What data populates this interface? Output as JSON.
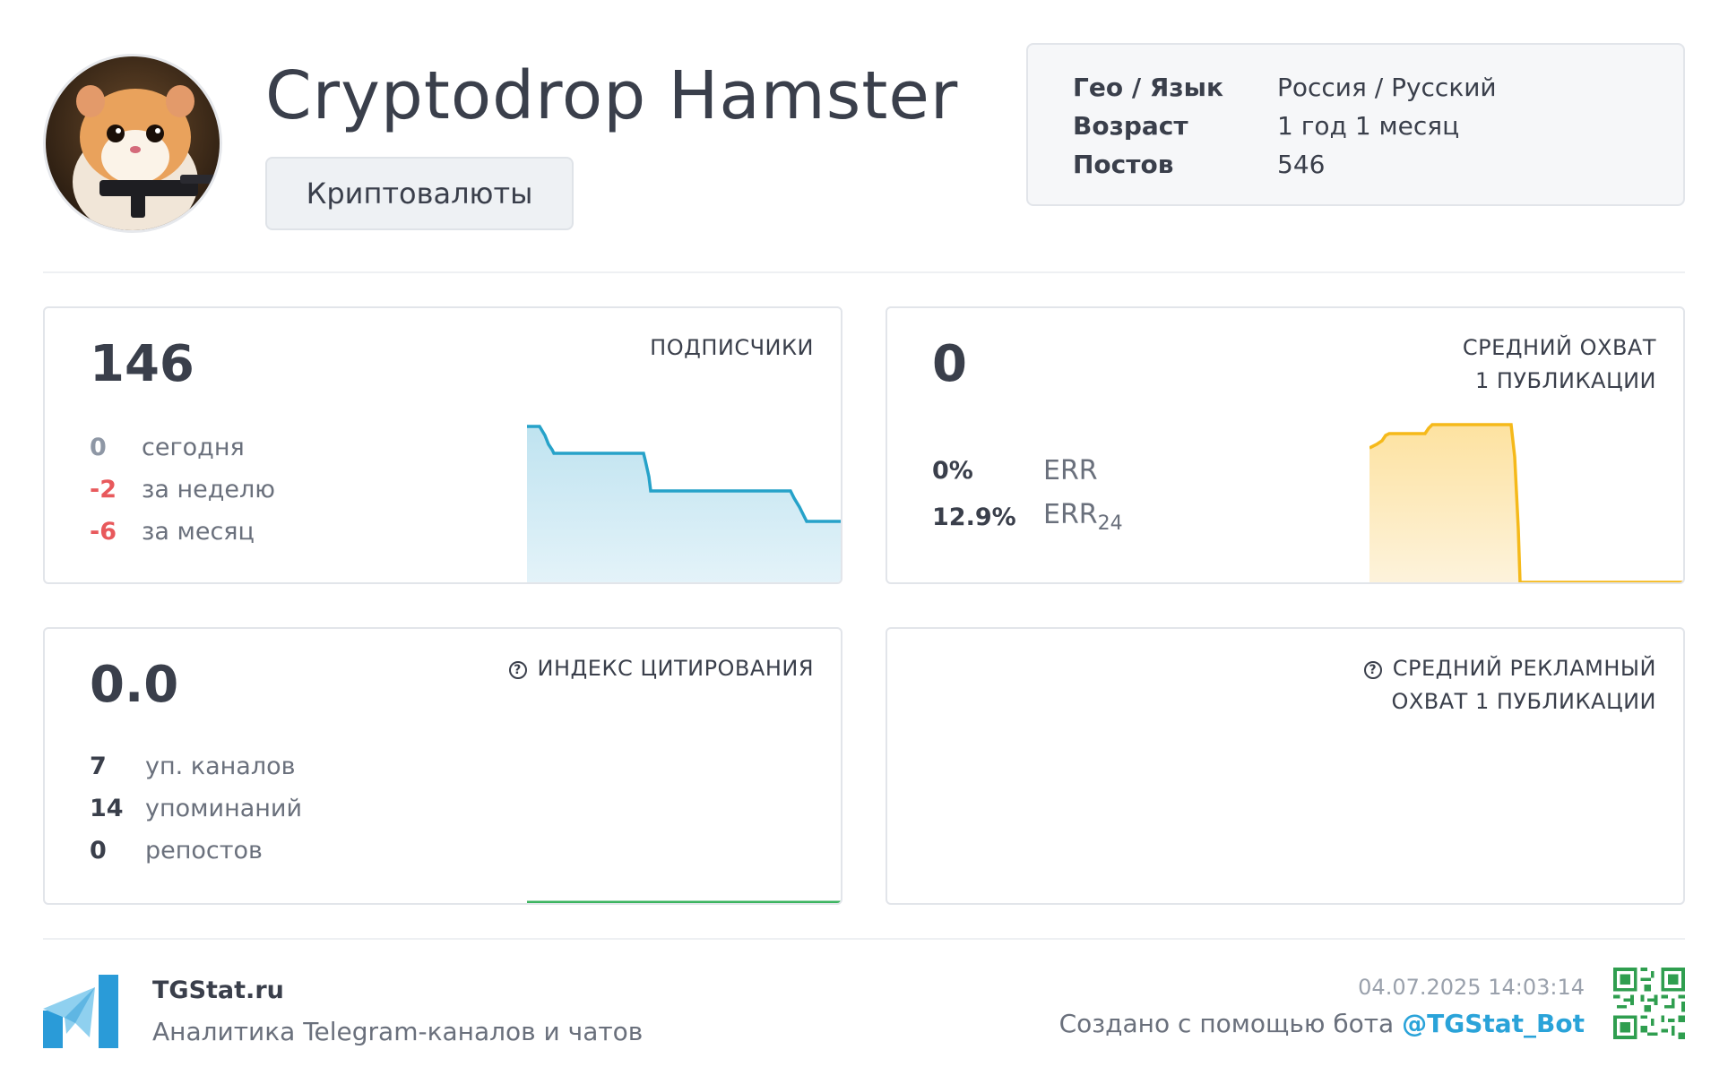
{
  "channel": {
    "title": "Cryptodrop Hamster",
    "category": "Криптовалюты",
    "avatar_icon": "hamster-avatar-icon"
  },
  "info": [
    {
      "key": "Гео / Язык",
      "value": "Россия / Русский"
    },
    {
      "key": "Возраст",
      "value": "1 год 1 месяц"
    },
    {
      "key": "Постов",
      "value": "546"
    }
  ],
  "subscribers": {
    "value": "146",
    "label": "ПОДПИСЧИКИ",
    "stats": [
      {
        "num": "0",
        "text": "сегодня",
        "tone": "zero"
      },
      {
        "num": "-2",
        "text": "за неделю",
        "tone": "neg"
      },
      {
        "num": "-6",
        "text": "за месяц",
        "tone": "neg"
      }
    ],
    "color": "#26a2c9"
  },
  "reach": {
    "value": "0",
    "label_line1": "СРЕДНИЙ ОХВАТ",
    "label_line2": "1 ПУБЛИКАЦИИ",
    "err_value": "0%",
    "err_label": "ERR",
    "err24_value": "12.9%",
    "err24_label": "ERR",
    "err24_sub": "24",
    "color": "#f5b91a"
  },
  "citation": {
    "value": "0.0",
    "label": "ИНДЕКС ЦИТИРОВАНИЯ",
    "help_icon": "question-circle-icon",
    "stats": [
      {
        "num": "7",
        "text": "уп. каналов"
      },
      {
        "num": "14",
        "text": "упоминаний"
      },
      {
        "num": "0",
        "text": "репостов"
      }
    ],
    "color": "#3cb460"
  },
  "ad_reach": {
    "label_line1": "СРЕДНИЙ РЕКЛАМНЫЙ",
    "label_line2": "ОХВАТ 1 ПУБЛИКАЦИИ",
    "help_icon": "question-circle-icon"
  },
  "footer": {
    "brand": "TGStat.ru",
    "subtitle": "Аналитика Telegram-каналов и чатов",
    "timestamp": "04.07.2025 14:03:14",
    "made_with": "Создано с помощью бота",
    "bot": "@TGStat_Bot",
    "logo_icon": "tgstat-logo-icon",
    "qr_icon": "qr-code-icon"
  }
}
